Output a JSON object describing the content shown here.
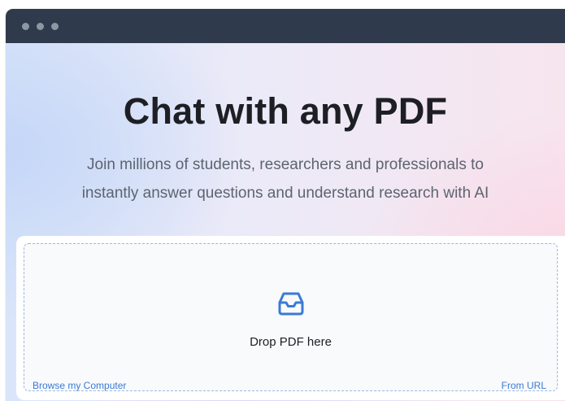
{
  "window": {
    "controls": [
      "window-dot-1",
      "window-dot-2",
      "window-dot-3"
    ]
  },
  "hero": {
    "title": "Chat with any PDF",
    "subtitle_line_1": "Join millions of students, researchers and professionals to",
    "subtitle_line_2": "instantly answer questions and understand research with AI"
  },
  "upload": {
    "icon": "inbox-tray-icon",
    "drop_label": "Drop PDF here",
    "browse_label": "Browse my Computer",
    "url_label": "From URL"
  },
  "colors": {
    "titlebar": "#2f3a4c",
    "accent": "#3a7bd5",
    "heading": "#1d1f24",
    "subtitle": "#5d6470"
  }
}
